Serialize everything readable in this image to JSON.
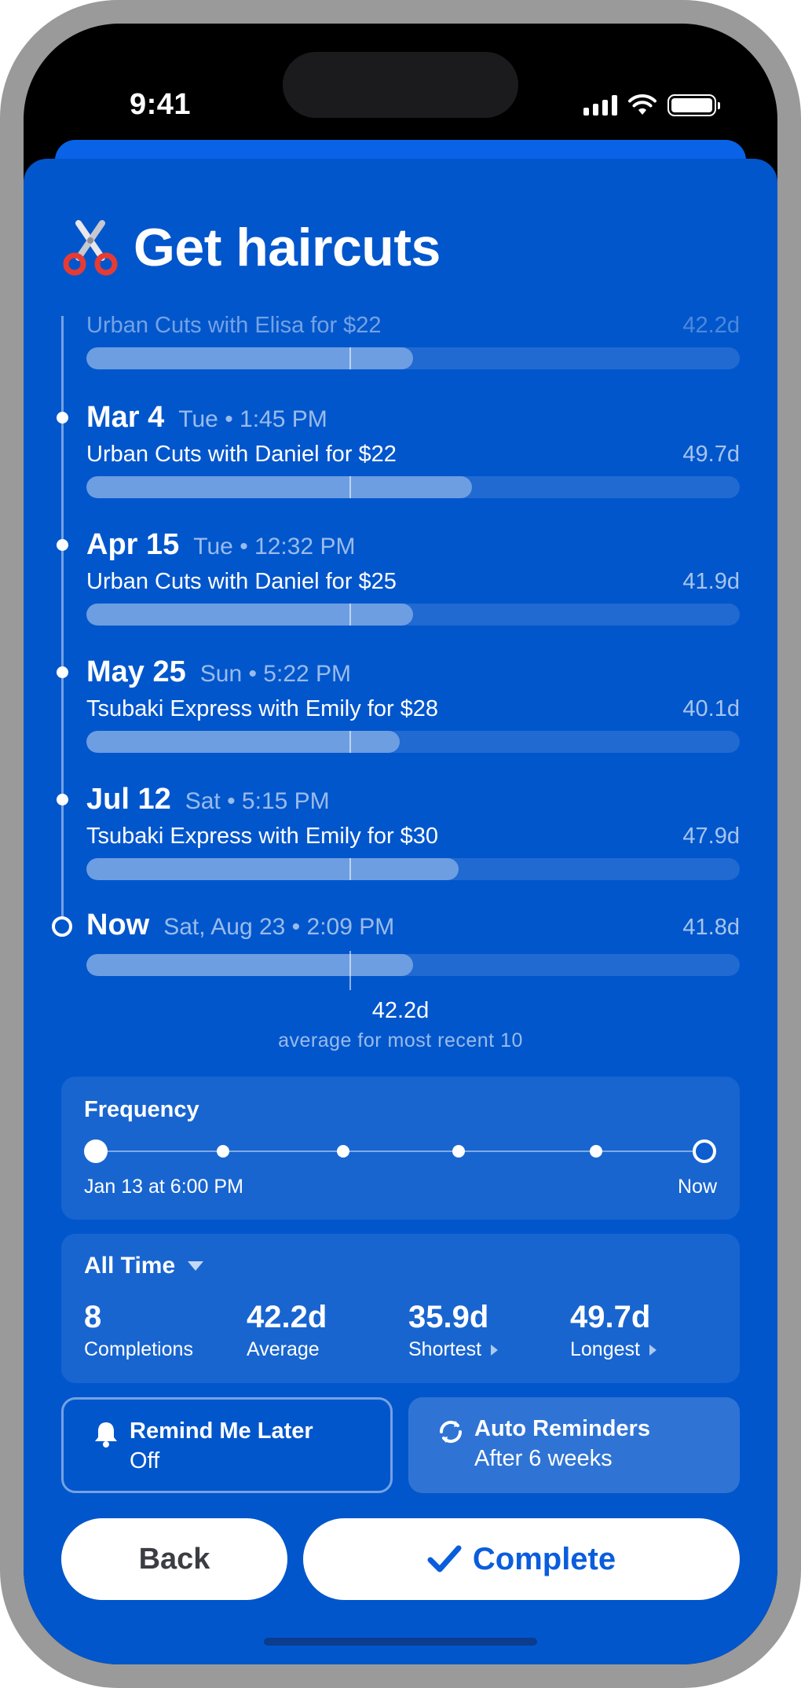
{
  "status_bar": {
    "time": "9:41"
  },
  "header": {
    "emoji": "scissors-icon",
    "title": "Get haircuts"
  },
  "timeline": {
    "entries": [
      {
        "date": "",
        "meta": "",
        "description": "Urban Cuts with Elisa for $22",
        "days": "42.2d",
        "fill": 0.5
      },
      {
        "date": "Mar 4",
        "meta": "Tue • 1:45 PM",
        "description": "Urban Cuts with Daniel for $22",
        "days": "49.7d",
        "fill": 0.59
      },
      {
        "date": "Apr 15",
        "meta": "Tue • 12:32 PM",
        "description": "Urban Cuts with Daniel for $25",
        "days": "41.9d",
        "fill": 0.5
      },
      {
        "date": "May 25",
        "meta": "Sun • 5:22 PM",
        "description": "Tsubaki Express with Emily for $28",
        "days": "40.1d",
        "fill": 0.48
      },
      {
        "date": "Jul 12",
        "meta": "Sat • 5:15 PM",
        "description": "Tsubaki Express with Emily for $30",
        "days": "47.9d",
        "fill": 0.57
      }
    ],
    "now": {
      "label": "Now",
      "meta": "Sat, Aug 23 • 2:09 PM",
      "days": "41.8d",
      "fill": 0.5
    },
    "average_value": "42.2d",
    "average_label": "average for most recent 10"
  },
  "frequency": {
    "title": "Frequency",
    "start_label": "Jan 13 at 6:00 PM",
    "end_label": "Now"
  },
  "stats": {
    "period": "All Time",
    "items": [
      {
        "value": "8",
        "label": "Completions"
      },
      {
        "value": "42.2d",
        "label": "Average"
      },
      {
        "value": "35.9d",
        "label": "Shortest"
      },
      {
        "value": "49.7d",
        "label": "Longest"
      }
    ]
  },
  "options": {
    "remind": {
      "title": "Remind Me Later",
      "value": "Off",
      "icon": "bell-icon"
    },
    "auto": {
      "title": "Auto Reminders",
      "value": "After 6 weeks",
      "icon": "refresh-icon"
    }
  },
  "actions": {
    "back": "Back",
    "complete": "Complete"
  },
  "colors": {
    "background": "#0256cc",
    "accent": "#0a5ddc"
  }
}
